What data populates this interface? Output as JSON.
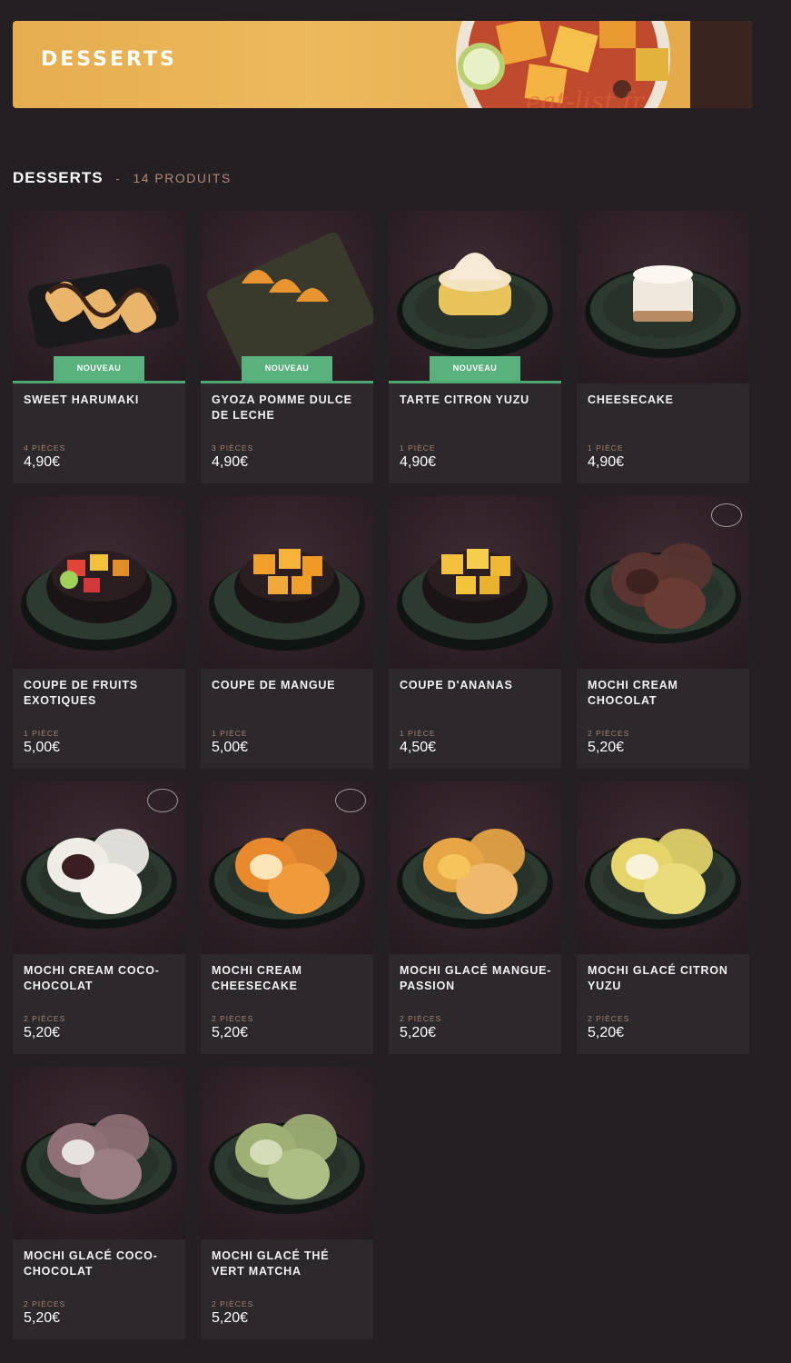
{
  "banner": {
    "title": "DESSERTS",
    "watermark": "eat-list.fr"
  },
  "section": {
    "title": "DESSERTS",
    "separator": "-",
    "count": "14 PRODUITS"
  },
  "products": [
    {
      "name": "SWEET HARUMAKI",
      "qty": "4 PIÈCES",
      "price": "4,90€",
      "badge": "NOUVEAU",
      "dish": "rolls"
    },
    {
      "name": "GYOZA POMME DULCE DE LECHE",
      "qty": "3 PIÈCES",
      "price": "4,90€",
      "badge": "NOUVEAU",
      "dish": "gyoza"
    },
    {
      "name": "TARTE CITRON YUZU",
      "qty": "1 PIÈCE",
      "price": "4,90€",
      "badge": "NOUVEAU",
      "dish": "tart"
    },
    {
      "name": "CHEESECAKE",
      "qty": "1 PIÈCE",
      "price": "4,90€",
      "badge": "",
      "dish": "cheesecake"
    },
    {
      "name": "COUPE DE FRUITS EXOTIQUES",
      "qty": "1 PIÈCE",
      "price": "5,00€",
      "badge": "",
      "dish": "fruit-bowl"
    },
    {
      "name": "COUPE DE MANGUE",
      "qty": "1 PIÈCE",
      "price": "5,00€",
      "badge": "",
      "dish": "mango-bowl"
    },
    {
      "name": "COUPE D'ANANAS",
      "qty": "1 PIÈCE",
      "price": "4,50€",
      "badge": "",
      "dish": "pineapple-bowl"
    },
    {
      "name": "MOCHI CREAM CHOCOLAT",
      "qty": "2 PIÈCES",
      "price": "5,20€",
      "badge": "",
      "dish": "mochi-chocolate"
    },
    {
      "name": "MOCHI CREAM COCO-CHOCOLAT",
      "qty": "2 PIÈCES",
      "price": "5,20€",
      "badge": "",
      "dish": "mochi-coco"
    },
    {
      "name": "MOCHI CREAM CHEESECAKE",
      "qty": "2 PIÈCES",
      "price": "5,20€",
      "badge": "",
      "dish": "mochi-orange"
    },
    {
      "name": "MOCHI GLACÉ MANGUE-PASSION",
      "qty": "2 PIÈCES",
      "price": "5,20€",
      "badge": "",
      "dish": "mochi-mango"
    },
    {
      "name": "MOCHI GLACÉ CITRON YUZU",
      "qty": "2 PIÈCES",
      "price": "5,20€",
      "badge": "",
      "dish": "mochi-yuzu"
    },
    {
      "name": "MOCHI GLACÉ COCO-CHOCOLAT",
      "qty": "2 PIÈCES",
      "price": "5,20€",
      "badge": "",
      "dish": "mochi-coco-glace"
    },
    {
      "name": "MOCHI GLACÉ THÉ VERT MATCHA",
      "qty": "2 PIÈCES",
      "price": "5,20€",
      "badge": "",
      "dish": "mochi-matcha"
    }
  ],
  "colors": {
    "badge": "#59b27e",
    "background": "#231f22",
    "card": "#2c282c",
    "qty": "#a9826f"
  }
}
